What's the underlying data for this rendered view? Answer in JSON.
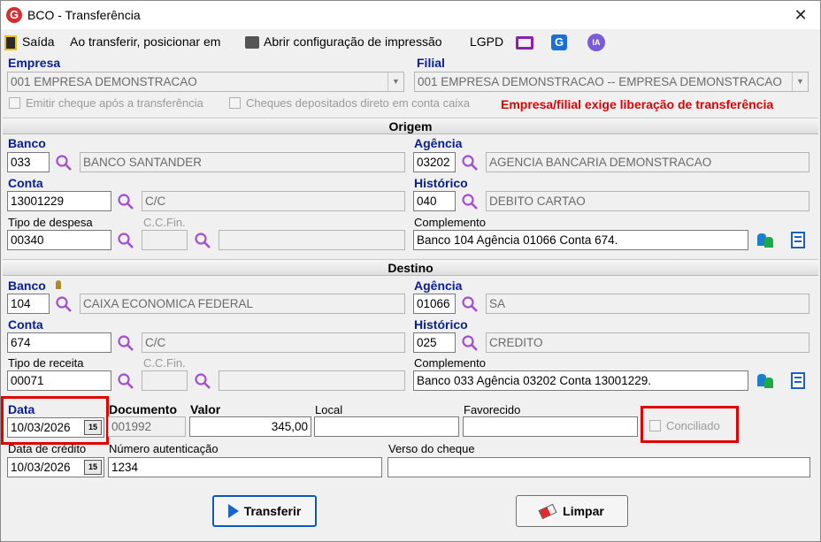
{
  "window": {
    "title": "BCO - Transferência",
    "close": "✕"
  },
  "toolbar": {
    "exit": "Saída",
    "position_on_transfer": "Ao transferir, posicionar em",
    "print_config": "Abrir configuração de impressão",
    "lgpd": "LGPD"
  },
  "header": {
    "empresa_label": "Empresa",
    "empresa_value": "001 EMPRESA DEMONSTRACAO",
    "filial_label": "Filial",
    "filial_value": "001 EMPRESA DEMONSTRACAO -- EMPRESA DEMONSTRACAO",
    "emit_check_label": "Emitir cheque após a transferência",
    "deposited_checks_label": "Cheques depositados direto em conta caixa",
    "warning": "Empresa/filial exige liberação de transferência"
  },
  "origem": {
    "section_title": "Origem",
    "banco_label": "Banco",
    "banco_code": "033",
    "banco_name": "BANCO SANTANDER",
    "agencia_label": "Agência",
    "agencia_code": "03202",
    "agencia_name": "AGENCIA BANCARIA DEMONSTRACAO",
    "conta_label": "Conta",
    "conta_value": "13001229",
    "conta_type": "C/C",
    "historico_label": "Histórico",
    "historico_code": "040",
    "historico_name": "DEBITO CARTAO",
    "tipo_label": "Tipo de despesa",
    "tipo_value": "00340",
    "ccfin_label": "C.C.Fin.",
    "complemento_label": "Complemento",
    "complemento_value": "Banco 104 Agência 01066 Conta 674."
  },
  "destino": {
    "section_title": "Destino",
    "banco_label": "Banco",
    "banco_code": "104",
    "banco_name": "CAIXA ECONOMICA FEDERAL",
    "agencia_label": "Agência",
    "agencia_code": "01066",
    "agencia_name": "SA",
    "conta_label": "Conta",
    "conta_value": "674",
    "conta_type": "C/C",
    "historico_label": "Histórico",
    "historico_code": "025",
    "historico_name": "CREDITO",
    "tipo_label": "Tipo de receita",
    "tipo_value": "00071",
    "ccfin_label": "C.C.Fin.",
    "complemento_label": "Complemento",
    "complemento_value": "Banco 033 Agência 03202 Conta 13001229."
  },
  "footer": {
    "data_label": "Data",
    "data_value": "10/03/2026",
    "documento_label": "Documento",
    "documento_value": "001992",
    "valor_label": "Valor",
    "valor_value": "345,00",
    "local_label": "Local",
    "local_value": "",
    "favorecido_label": "Favorecido",
    "favorecido_value": "",
    "conciliado_label": "Conciliado",
    "data_credito_label": "Data de crédito",
    "data_credito_value": "10/03/2026",
    "autenticacao_label": "Número autenticação",
    "autenticacao_value": "1234",
    "verso_label": "Verso do cheque",
    "verso_value": "",
    "calendar_glyph": "15"
  },
  "buttons": {
    "transfer": "Transferir",
    "clear": "Limpar"
  },
  "colors": {
    "label_blue": "#0a1f8f",
    "warning_red": "#e00000",
    "highlight_red": "#e00000",
    "focus_blue": "#0a57c2"
  }
}
